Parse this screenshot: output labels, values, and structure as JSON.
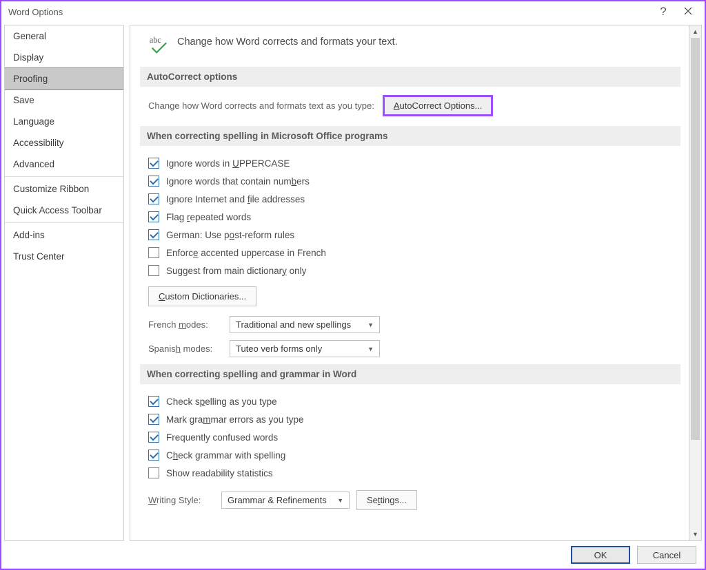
{
  "window": {
    "title": "Word Options",
    "help_tooltip": "?",
    "close_tooltip": "Close"
  },
  "sidebar": {
    "items": [
      {
        "label": "General",
        "active": false
      },
      {
        "label": "Display",
        "active": false
      },
      {
        "label": "Proofing",
        "active": true
      },
      {
        "label": "Save",
        "active": false
      },
      {
        "label": "Language",
        "active": false
      },
      {
        "label": "Accessibility",
        "active": false
      },
      {
        "label": "Advanced",
        "active": false
      }
    ],
    "items2": [
      {
        "label": "Customize Ribbon"
      },
      {
        "label": "Quick Access Toolbar"
      }
    ],
    "items3": [
      {
        "label": "Add-ins"
      },
      {
        "label": "Trust Center"
      }
    ]
  },
  "header": {
    "text": "Change how Word corrects and formats your text."
  },
  "sections": {
    "autocorrect": {
      "title": "AutoCorrect options",
      "desc": "Change how Word corrects and formats text as you type:",
      "button": "AutoCorrect Options..."
    },
    "office_spelling": {
      "title": "When correcting spelling in Microsoft Office programs",
      "checks": [
        {
          "text_pre": "Ignore words in ",
          "u": "U",
          "text_post": "PPERCASE",
          "checked": true
        },
        {
          "text_pre": "Ignore words that contain num",
          "u": "b",
          "text_post": "ers",
          "checked": true
        },
        {
          "text_pre": "Ignore Internet and ",
          "u": "f",
          "text_post": "ile addresses",
          "checked": true
        },
        {
          "text_pre": "Flag ",
          "u": "r",
          "text_post": "epeated words",
          "checked": true
        },
        {
          "text_pre": "German: Use p",
          "u": "o",
          "text_post": "st-reform rules",
          "checked": true
        },
        {
          "text_pre": "Enforc",
          "u": "e",
          "text_post": " accented uppercase in French",
          "checked": false
        },
        {
          "text_pre": "Suggest from main dictionar",
          "u": "y",
          "text_post": " only",
          "checked": false
        }
      ],
      "custom_dict_btn": "Custom Dictionaries...",
      "french_label": "French modes:",
      "french_value": "Traditional and new spellings",
      "spanish_label": "Spanish modes:",
      "spanish_value": "Tuteo verb forms only"
    },
    "word_spelling": {
      "title": "When correcting spelling and grammar in Word",
      "checks": [
        {
          "text_pre": "Check s",
          "u": "p",
          "text_post": "elling as you type",
          "checked": true
        },
        {
          "text_pre": "Mark gra",
          "u": "m",
          "text_post": "mar errors as you type",
          "checked": true
        },
        {
          "text_pre": "Frequently confused words",
          "u": "",
          "text_post": "",
          "checked": true
        },
        {
          "text_pre": "C",
          "u": "h",
          "text_post": "eck grammar with spelling",
          "checked": true
        },
        {
          "text_pre": "Show readability statistics",
          "u": "",
          "text_post": "",
          "checked": false
        }
      ],
      "style_label": "Writing Style:",
      "style_value": "Grammar & Refinements",
      "settings_btn": "Settings..."
    }
  },
  "footer": {
    "ok": "OK",
    "cancel": "Cancel"
  }
}
